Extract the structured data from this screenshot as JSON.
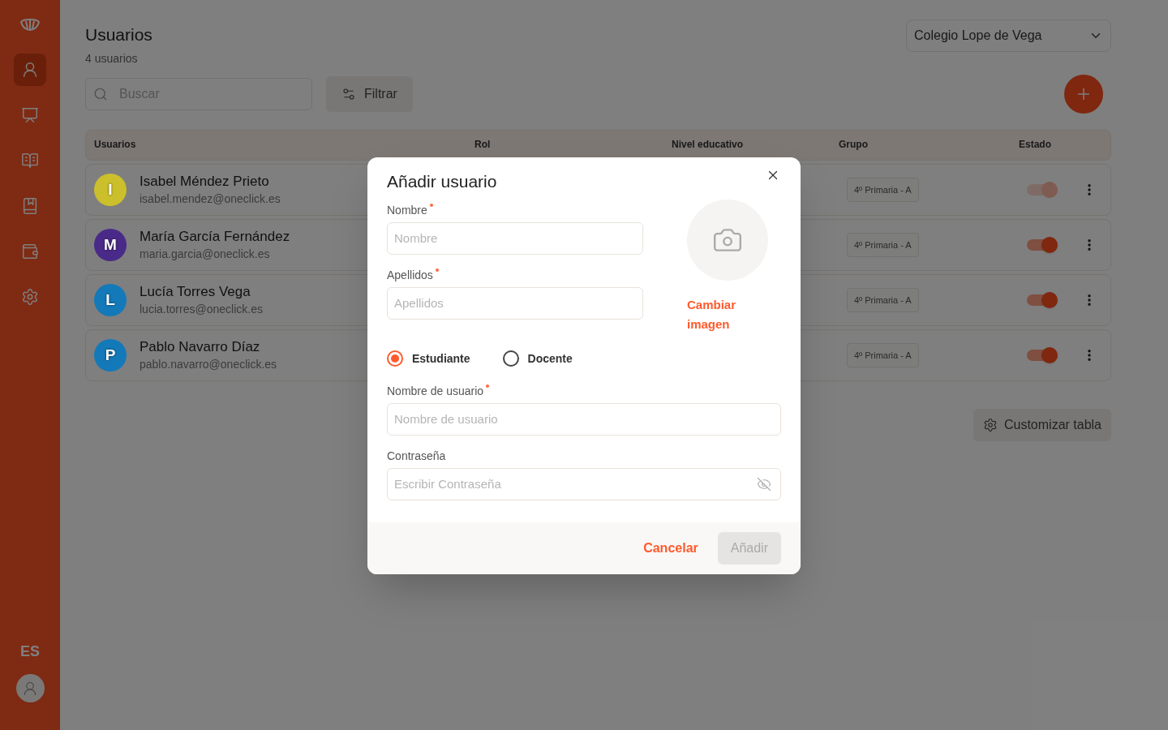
{
  "sidebar": {
    "items": [
      {
        "kind": "users",
        "selected": true
      },
      {
        "kind": "board",
        "selected": false
      },
      {
        "kind": "book",
        "selected": false
      },
      {
        "kind": "bookmark",
        "selected": false
      },
      {
        "kind": "wallet",
        "selected": false
      },
      {
        "kind": "settings",
        "selected": false
      }
    ],
    "language": "ES"
  },
  "page": {
    "title": "Usuarios",
    "count": "4 usuarios",
    "school": "Colegio Lope de Vega"
  },
  "search": {
    "placeholder": "Buscar"
  },
  "filter_button": "Filtrar",
  "table": {
    "columns": [
      "Usuarios",
      "Rol",
      "Nivel educativo",
      "Grupo",
      "Estado"
    ],
    "rows": [
      {
        "initial": "I",
        "name": "Isabel Méndez Prieto",
        "email": "isabel.mendez@oneclick.es",
        "color": "#cbbf2c",
        "group": "4º Primaria - A",
        "on": true,
        "disabled": true
      },
      {
        "initial": "M",
        "name": "María García Fernández",
        "email": "maria.garcia@oneclick.es",
        "color": "#4a2a88",
        "group": "4º Primaria - A",
        "on": true,
        "disabled": false
      },
      {
        "initial": "L",
        "name": "Lucía Torres Vega",
        "email": "lucia.torres@oneclick.es",
        "color": "#1479b8",
        "group": "4º Primaria - A",
        "on": true,
        "disabled": false
      },
      {
        "initial": "P",
        "name": "Pablo Navarro Díaz",
        "email": "pablo.navarro@oneclick.es",
        "color": "#1479b8",
        "group": "4º Primaria - A",
        "on": true,
        "disabled": false
      }
    ]
  },
  "customize_button": "Customizar tabla",
  "dialog": {
    "title": "Añadir usuario",
    "first_name": {
      "label": "Nombre",
      "required": true,
      "placeholder": "Nombre"
    },
    "last_name": {
      "label": "Apellidos",
      "required": true,
      "placeholder": "Apellidos"
    },
    "change_image": "Cambiar imagen",
    "roles": [
      {
        "label": "Estudiante",
        "selected": true
      },
      {
        "label": "Docente",
        "selected": false
      }
    ],
    "username": {
      "label": "Nombre de usuario",
      "required": true,
      "placeholder": "Nombre de usuario"
    },
    "password": {
      "label": "Contraseña",
      "placeholder": "Escribir Contraseña"
    },
    "cancel": "Cancelar",
    "submit": "Añadir",
    "submit_disabled": true
  }
}
